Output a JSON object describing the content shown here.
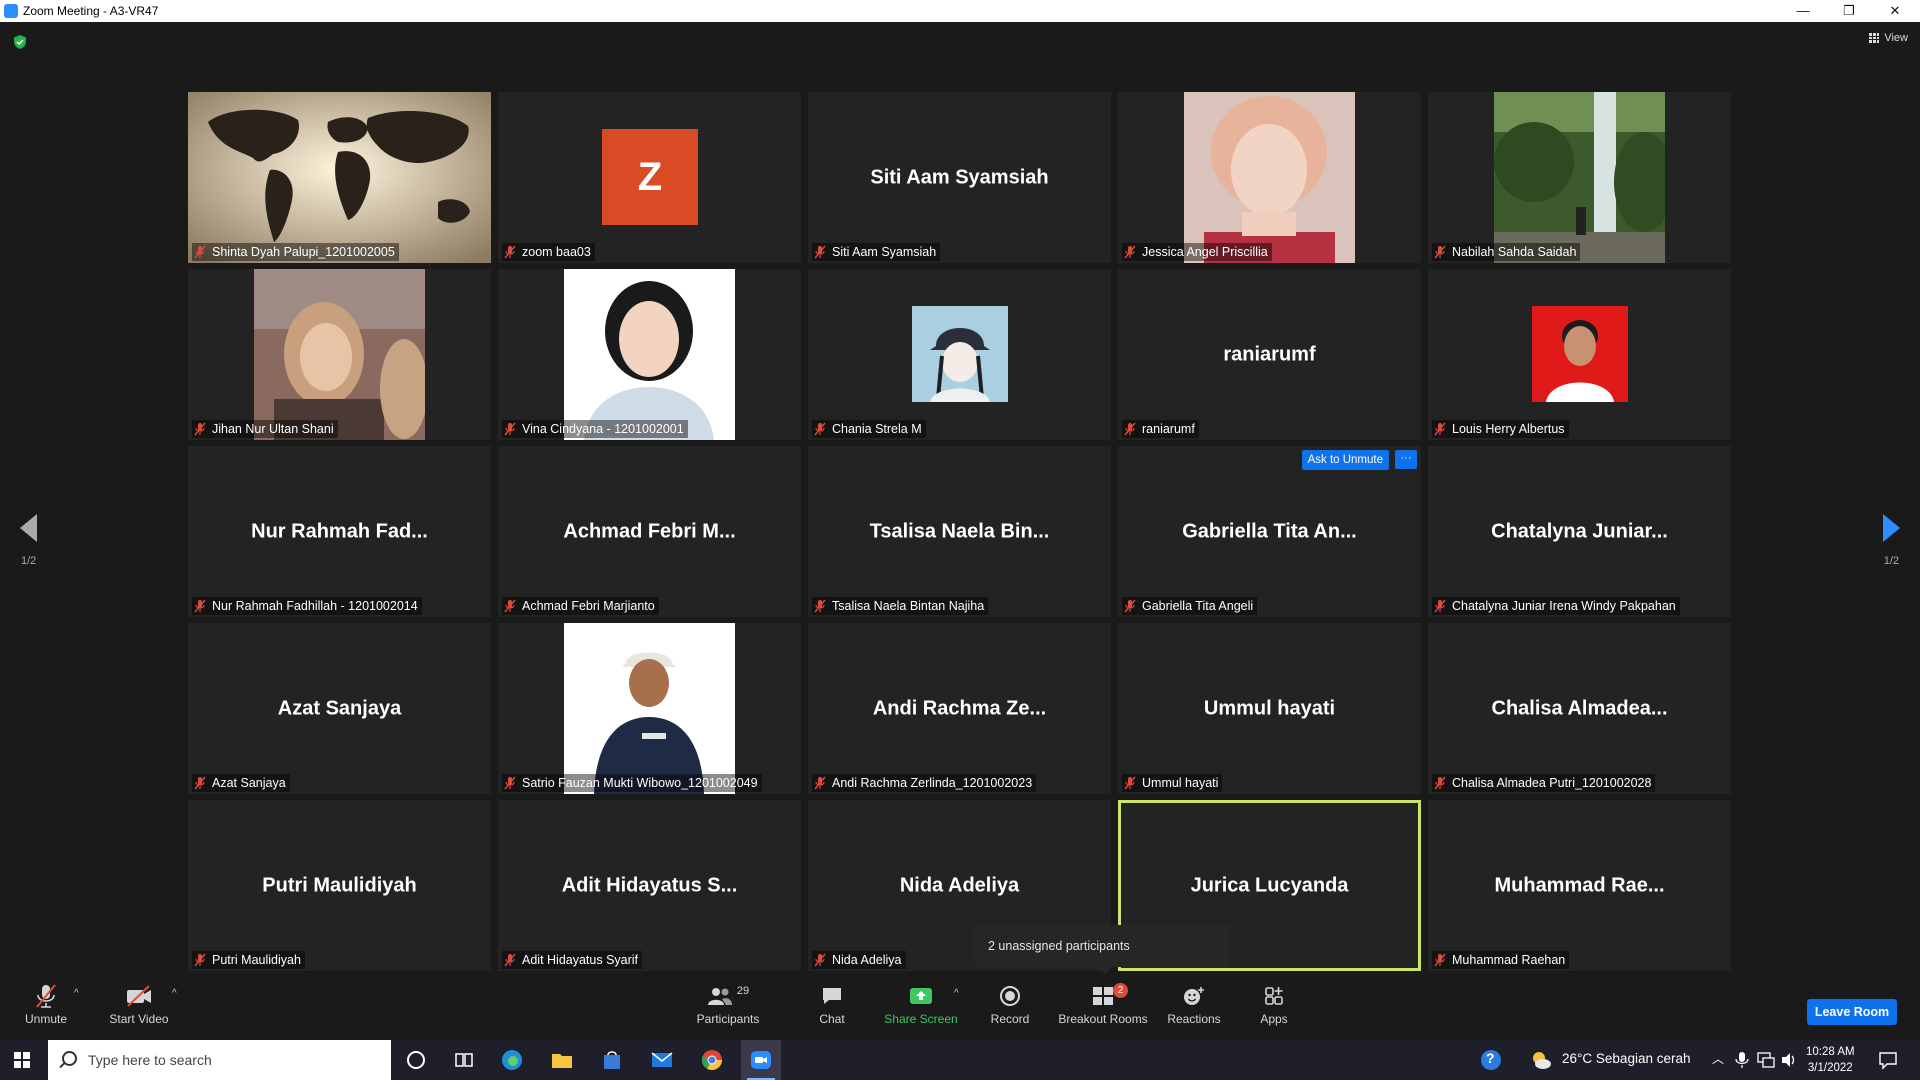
{
  "window": {
    "title": "Zoom Meeting - A3-VR47",
    "minimize": "—",
    "restore": "❐",
    "close": "✕"
  },
  "top": {
    "view_label": "View"
  },
  "pager": {
    "left_page": "1/2",
    "right_page": "1/2"
  },
  "tiles": [
    {
      "label": "Shinta Dyah Palupi_1201002005"
    },
    {
      "label": "zoom baa03",
      "avatar_letter": "Z"
    },
    {
      "label": "Siti Aam Syamsiah",
      "big_name": "Siti Aam Syamsiah"
    },
    {
      "label": "Jessica Angel Priscillia"
    },
    {
      "label": "Nabilah Sahda Saidah"
    },
    {
      "label": "Jihan Nur Ultan Shani"
    },
    {
      "label": "Vina Cindyana - 1201002001"
    },
    {
      "label": "Chania Strela M"
    },
    {
      "label": "raniarumf",
      "big_name": "raniarumf"
    },
    {
      "label": "Louis Herry Albertus"
    },
    {
      "label": "Nur Rahmah Fadhillah - 1201002014",
      "big_name": "Nur Rahmah Fad..."
    },
    {
      "label": "Achmad Febri Marjianto",
      "big_name": "Achmad Febri M..."
    },
    {
      "label": "Tsalisa Naela Bintan Najiha",
      "big_name": "Tsalisa Naela Bin..."
    },
    {
      "label": "Gabriella Tita Angeli",
      "big_name": "Gabriella Tita An...",
      "ask_unmute": "Ask to Unmute",
      "more": "···"
    },
    {
      "label": "Chatalyna Juniar Irena Windy Pakpahan",
      "big_name": "Chatalyna Juniar..."
    },
    {
      "label": "Azat Sanjaya",
      "big_name": "Azat Sanjaya"
    },
    {
      "label": "Satrio Fauzan Mukti Wibowo_1201002049"
    },
    {
      "label": "Andi Rachma Zerlinda_1201002023",
      "big_name": "Andi Rachma Ze..."
    },
    {
      "label": "Ummul hayati",
      "big_name": "Ummul hayati"
    },
    {
      "label": "Chalisa Almadea Putri_1201002028",
      "big_name": "Chalisa Almadea..."
    },
    {
      "label": "Putri Maulidiyah",
      "big_name": "Putri Maulidiyah"
    },
    {
      "label": "Adit Hidayatus Syarif",
      "big_name": "Adit Hidayatus S..."
    },
    {
      "label": "Nida Adeliya",
      "big_name": "Nida Adeliya"
    },
    {
      "label": "",
      "big_name": "Jurica Lucyanda"
    },
    {
      "label": "Muhammad Raehan",
      "big_name": "Muhammad Rae..."
    }
  ],
  "tooltip": "2 unassigned participants",
  "toolbar": {
    "unmute": "Unmute",
    "start_video": "Start Video",
    "participants": "Participants",
    "participants_count": "29",
    "chat": "Chat",
    "share_screen": "Share Screen",
    "record": "Record",
    "breakout_rooms": "Breakout Rooms",
    "breakout_badge": "2",
    "reactions": "Reactions",
    "apps": "Apps",
    "leave_room": "Leave Room",
    "caret": "^"
  },
  "taskbar": {
    "search_placeholder": "Type here to search",
    "help": "?",
    "weather": "26°C  Sebagian cerah",
    "time": "10:28 AM",
    "date": "3/1/2022"
  },
  "colors": {
    "accent": "#0e72ed",
    "active_speaker": "#c9e66b",
    "share_green": "#3ec763",
    "muted_red": "#e04a3a",
    "zoom_avatar": "#d94a25"
  }
}
